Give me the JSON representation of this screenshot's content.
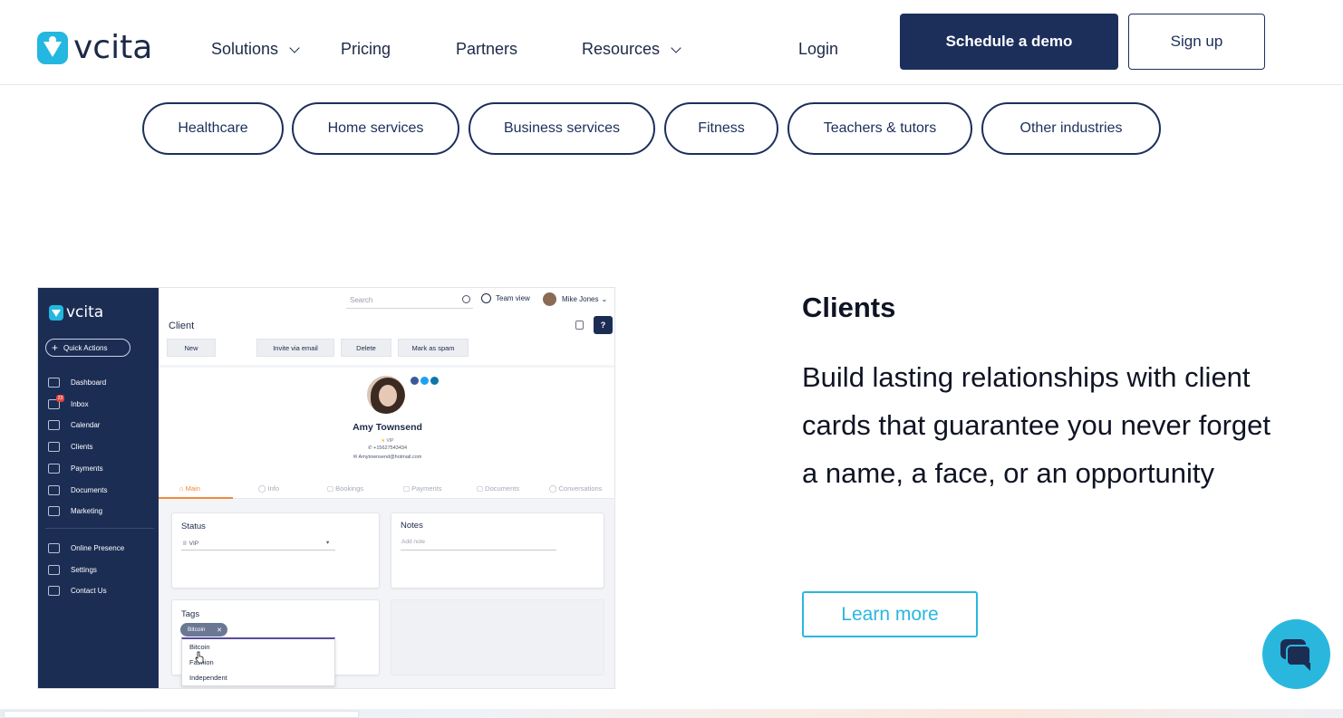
{
  "brand": {
    "name": "vcita",
    "accent": "#24b7e0",
    "navy": "#1c2f5b"
  },
  "nav": {
    "items": [
      {
        "label": "Solutions",
        "has_dropdown": true
      },
      {
        "label": "Pricing",
        "has_dropdown": false
      },
      {
        "label": "Partners",
        "has_dropdown": false
      },
      {
        "label": "Resources",
        "has_dropdown": true
      }
    ],
    "login": "Login",
    "demo": "Schedule a demo",
    "signup": "Sign up"
  },
  "industries": [
    "Healthcare",
    "Home services",
    "Business services",
    "Fitness",
    "Teachers & tutors",
    "Other industries"
  ],
  "app": {
    "logo": "vcita",
    "quick_actions": "Quick Actions",
    "sidebar": [
      {
        "label": "Dashboard",
        "icon": "dashboard-icon"
      },
      {
        "label": "Inbox",
        "icon": "inbox-icon",
        "badge": "23"
      },
      {
        "label": "Calendar",
        "icon": "calendar-icon"
      },
      {
        "label": "Clients",
        "icon": "clients-icon"
      },
      {
        "label": "Payments",
        "icon": "payments-icon"
      },
      {
        "label": "Documents",
        "icon": "documents-icon"
      },
      {
        "label": "Marketing",
        "icon": "marketing-icon"
      },
      {
        "label": "Online Presence",
        "icon": "globe-icon"
      },
      {
        "label": "Settings",
        "icon": "settings-icon"
      },
      {
        "label": "Contact Us",
        "icon": "mail-icon"
      }
    ],
    "search_placeholder": "Search",
    "team_view": "Team view",
    "user": "Mike Jones",
    "page_title": "Client",
    "help": "?",
    "actions": [
      "New",
      "Invite via email",
      "Delete",
      "Mark as spam"
    ],
    "client": {
      "name": "Amy Townsend",
      "status_badge": "VIP",
      "phone": "+15627543434",
      "email": "Amytownsend@hotmail.com"
    },
    "tabs": [
      "Main",
      "Info",
      "Bookings",
      "Payments",
      "Documents",
      "Conversations"
    ],
    "status": {
      "label": "Status",
      "value": "VIP"
    },
    "notes": {
      "label": "Notes",
      "placeholder": "Add note"
    },
    "tags": {
      "label": "Tags",
      "selected": "Bitcoin",
      "options": [
        "Bitcoin",
        "Fashion",
        "Independent"
      ]
    }
  },
  "feature": {
    "title": "Clients",
    "description": "Build lasting relationships with client cards that guarantee you never forget a name, a face, or an opportunity",
    "cta": "Learn more"
  }
}
